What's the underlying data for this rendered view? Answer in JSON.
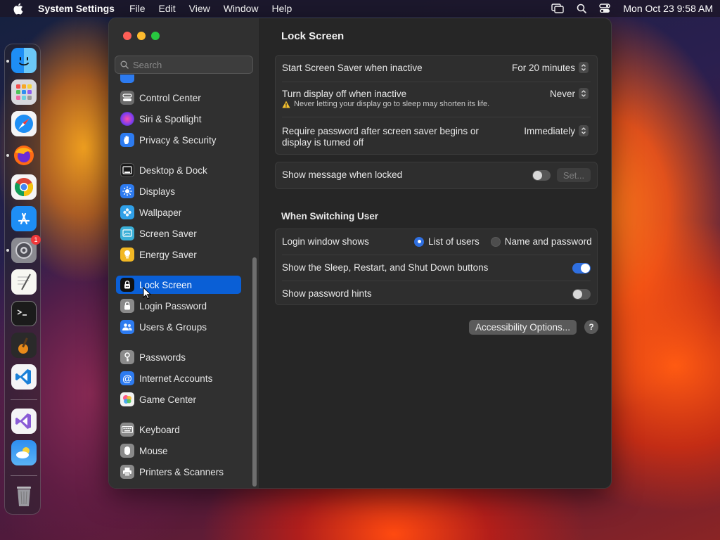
{
  "menubar": {
    "app_name": "System Settings",
    "menus": [
      "File",
      "Edit",
      "View",
      "Window",
      "Help"
    ],
    "clock": "Mon Oct 23  9:58 AM"
  },
  "dock": {
    "settings_badge": "1"
  },
  "sidebar": {
    "search_placeholder": "Search",
    "items": [
      {
        "label": "Control Center",
        "icon": "control-center-icon",
        "color": "#6b6b6b"
      },
      {
        "label": "Siri & Spotlight",
        "icon": "siri-icon",
        "color": "#a23cc8"
      },
      {
        "label": "Privacy & Security",
        "icon": "hand-icon",
        "color": "#2d7bf0"
      },
      {
        "label": "Desktop & Dock",
        "icon": "dock-icon",
        "color": "#1a1a1a"
      },
      {
        "label": "Displays",
        "icon": "sun-icon",
        "color": "#2d7bf0"
      },
      {
        "label": "Wallpaper",
        "icon": "flower-icon",
        "color": "#2fa0e8"
      },
      {
        "label": "Screen Saver",
        "icon": "screen-saver-icon",
        "color": "#3bb0d8"
      },
      {
        "label": "Energy Saver",
        "icon": "lightbulb-icon",
        "color": "#f2b824"
      },
      {
        "label": "Lock Screen",
        "icon": "lock-icon",
        "color": "#111111"
      },
      {
        "label": "Login Password",
        "icon": "lock-icon",
        "color": "#8a8a8a"
      },
      {
        "label": "Users & Groups",
        "icon": "users-icon",
        "color": "#2d7bf0"
      },
      {
        "label": "Passwords",
        "icon": "key-icon",
        "color": "#8a8a8a"
      },
      {
        "label": "Internet Accounts",
        "icon": "at-icon",
        "color": "#2d7bf0"
      },
      {
        "label": "Game Center",
        "icon": "game-center-icon",
        "color": "#e8e8e8"
      },
      {
        "label": "Keyboard",
        "icon": "keyboard-icon",
        "color": "#8a8a8a"
      },
      {
        "label": "Mouse",
        "icon": "mouse-icon",
        "color": "#8a8a8a"
      },
      {
        "label": "Printers & Scanners",
        "icon": "printer-icon",
        "color": "#8a8a8a"
      }
    ],
    "active_index": 8
  },
  "main": {
    "title": "Lock Screen",
    "screen_saver": {
      "label": "Start Screen Saver when inactive",
      "value": "For 20 minutes"
    },
    "display_off": {
      "label": "Turn display off when inactive",
      "value": "Never",
      "warning": "Never letting your display go to sleep may shorten its life."
    },
    "require_password": {
      "label_line1": "Require password after screen saver begins or",
      "label_line2": "display is turned off",
      "value": "Immediately"
    },
    "show_message": {
      "label": "Show message when locked",
      "enabled": false,
      "set_label": "Set..."
    },
    "switching_section": "When Switching User",
    "login_window": {
      "label": "Login window shows",
      "options": [
        "List of users",
        "Name and password"
      ],
      "selected": "List of users"
    },
    "sleep_buttons": {
      "label": "Show the Sleep, Restart, and Shut Down buttons",
      "enabled": true
    },
    "password_hints": {
      "label": "Show password hints",
      "enabled": false
    },
    "accessibility_label": "Accessibility Options...",
    "help_label": "?"
  },
  "colors": {
    "accent": "#0a5fd6",
    "toggle_on": "#2f6fe0",
    "window_bg": "#262626",
    "sidebar_bg": "#303030"
  }
}
